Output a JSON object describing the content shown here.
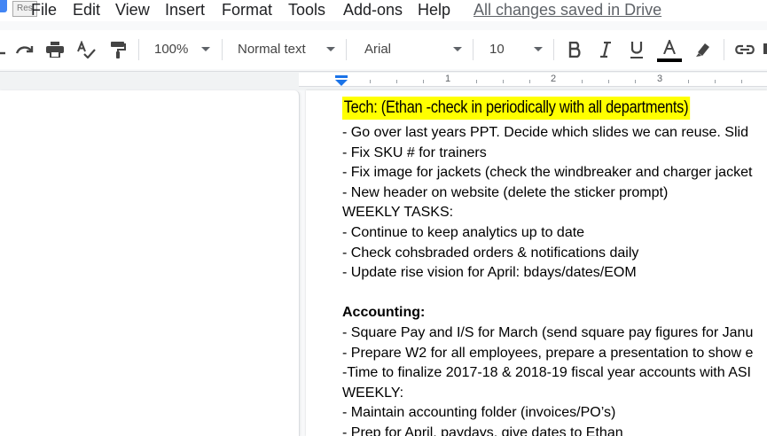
{
  "menu": {
    "tooltip": "Res",
    "items": [
      "File",
      "Edit",
      "View",
      "Insert",
      "Format",
      "Tools",
      "Add-ons",
      "Help"
    ],
    "save_status": "All changes saved in Drive"
  },
  "toolbar": {
    "zoom": "100%",
    "style": "Normal text",
    "font": "Arial",
    "font_size": "10",
    "text_color": "#000000"
  },
  "ruler": {
    "numbers": [
      "1",
      "2",
      "3"
    ]
  },
  "document": {
    "heading": "Tech: (Ethan -check in periodically with all departments)",
    "highlight_color": "#ffff00",
    "lines": [
      {
        "text": "- Go over last years PPT. Decide which slides we can reuse. Slid",
        "bold": false
      },
      {
        "text": "- Fix SKU # for trainers",
        "bold": false
      },
      {
        "text": "- Fix image for jackets (check the windbreaker and charger jacket",
        "bold": false
      },
      {
        "text": "- New header on website (delete the sticker prompt)",
        "bold": false
      },
      {
        "text": "WEEKLY TASKS:",
        "bold": false
      },
      {
        "text": "- Continue to keep analytics up to date",
        "bold": false
      },
      {
        "text": "- Check cohsbraded orders & notifications daily",
        "bold": false
      },
      {
        "text": "- Update rise vision for April: bdays/dates/EOM",
        "bold": false
      },
      {
        "text": "",
        "bold": false
      },
      {
        "text": "Accounting:",
        "bold": true
      },
      {
        "text": "- Square Pay and I/S for March (send square pay figures for Janu",
        "bold": false
      },
      {
        "text": "- Prepare W2 for all employees, prepare a presentation to show e",
        "bold": false
      },
      {
        "text": "-Time to finalize 2017-18 & 2018-19 fiscal year accounts with ASI",
        "bold": false
      },
      {
        "text": "WEEKLY:",
        "bold": false
      },
      {
        "text": "- Maintain accounting folder (invoices/PO’s)",
        "bold": false
      },
      {
        "text": "- Prep for April, paydays, give dates to Ethan",
        "bold": false
      }
    ]
  }
}
